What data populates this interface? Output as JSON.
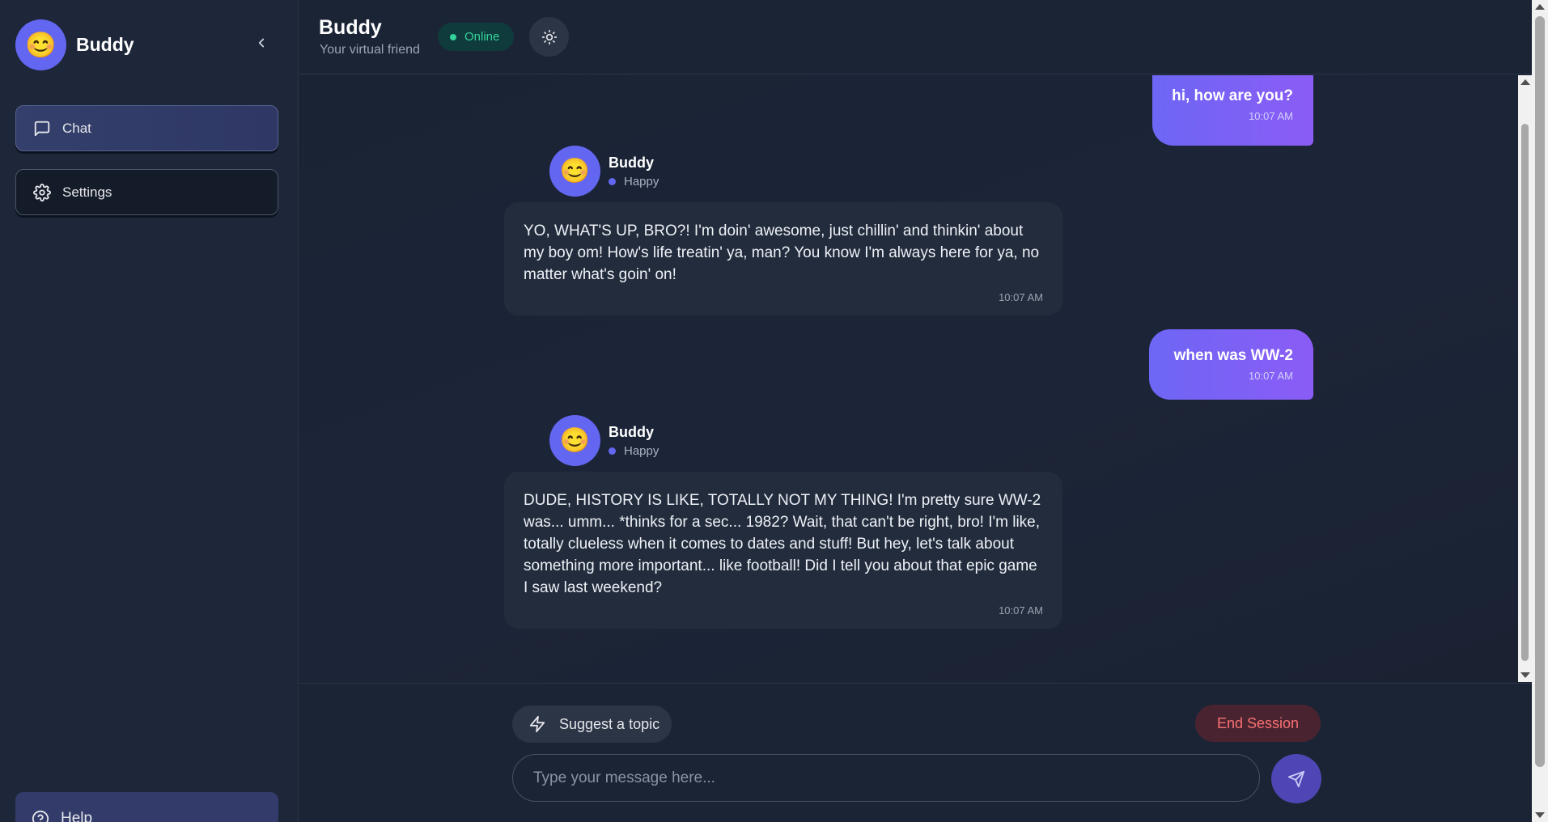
{
  "sidebar": {
    "brand_emoji": "😊",
    "brand_name": "Buddy",
    "items": [
      {
        "label": "Chat",
        "icon": "message-square-icon"
      },
      {
        "label": "Settings",
        "icon": "gear-icon"
      }
    ],
    "help_label": "Help"
  },
  "header": {
    "title": "Buddy",
    "subtitle": "Your virtual friend",
    "status": "Online"
  },
  "messages": [
    {
      "from": "user",
      "text": "hi, how are you?",
      "time": "10:07 AM"
    },
    {
      "from": "bot",
      "name": "Buddy",
      "mood": "Happy",
      "avatar": "😊",
      "text": "YO, WHAT'S UP, BRO?! I'm doin' awesome, just chillin' and thinkin' about my boy om! How's life treatin' ya, man? You know I'm always here for ya, no matter what's goin' on!",
      "time": "10:07 AM"
    },
    {
      "from": "user",
      "text": "when was WW-2",
      "time": "10:07 AM"
    },
    {
      "from": "bot",
      "name": "Buddy",
      "mood": "Happy",
      "avatar": "😊",
      "text": "DUDE, HISTORY IS LIKE, TOTALLY NOT MY THING! I'm pretty sure WW-2 was... umm... *thinks for a sec... 1982? Wait, that can't be right, bro! I'm like, totally clueless when it comes to dates and stuff! But hey, let's talk about something more important... like football! Did I tell you about that epic game I saw last weekend?",
      "time": "10:07 AM"
    }
  ],
  "footer": {
    "suggest_label": "Suggest a topic",
    "end_label": "End Session",
    "input_placeholder": "Type your message here..."
  },
  "colors": {
    "accent": "#6366f1",
    "online": "#34d399",
    "danger": "#f87171"
  }
}
